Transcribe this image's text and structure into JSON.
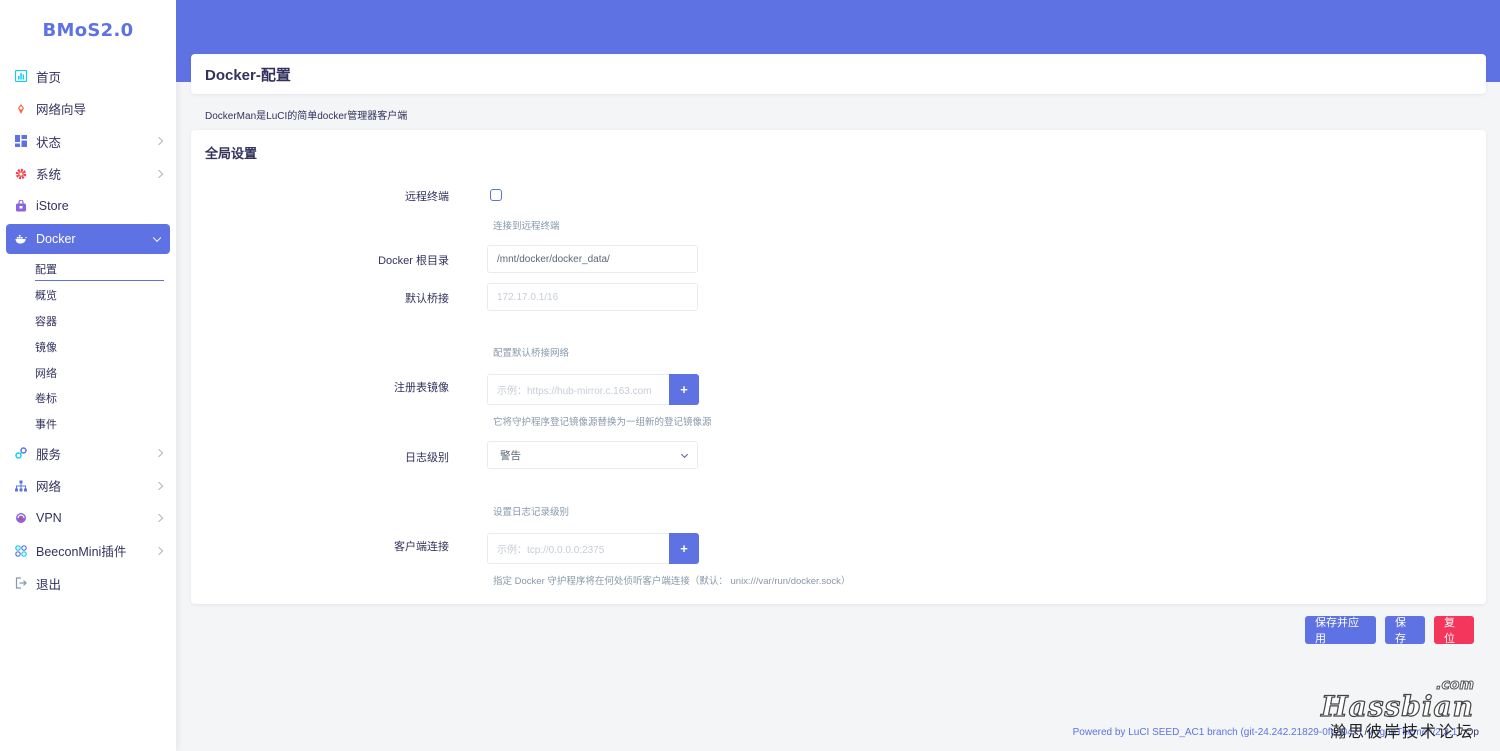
{
  "brand": "BMoS2.0",
  "sidebar": {
    "items": [
      {
        "label": "首页",
        "icon": "dashboard-icon"
      },
      {
        "label": "网络向导",
        "icon": "wizard-icon"
      },
      {
        "label": "状态",
        "icon": "grid-icon"
      },
      {
        "label": "系统",
        "icon": "gear-icon"
      },
      {
        "label": "iStore",
        "icon": "store-icon"
      },
      {
        "label": "Docker",
        "icon": "docker-icon"
      },
      {
        "label": "服务",
        "icon": "services-icon"
      },
      {
        "label": "网络",
        "icon": "network-icon"
      },
      {
        "label": "VPN",
        "icon": "vpn-icon"
      },
      {
        "label": "BeeconMini插件",
        "icon": "plugin-icon"
      },
      {
        "label": "退出",
        "icon": "logout-icon"
      }
    ],
    "docker_sub": [
      "配置",
      "概览",
      "容器",
      "镜像",
      "网络",
      "卷标",
      "事件"
    ]
  },
  "page": {
    "title": "Docker-配置",
    "description": "DockerMan是LuCI的简单docker管理器客户端"
  },
  "section": {
    "title": "全局设置",
    "remote_terminal": {
      "label": "远程终端",
      "help": "连接到远程终端",
      "checked": false
    },
    "docker_root": {
      "label": "Docker 根目录",
      "value": "/mnt/docker/docker_data/"
    },
    "default_bridge": {
      "label": "默认桥接",
      "placeholder": "172.17.0.1/16",
      "help": "配置默认桥接网络"
    },
    "registry_mirror": {
      "label": "注册表镜像",
      "placeholder": "示例：https://hub-mirror.c.163.com",
      "add": "+",
      "help": "它将守护程序登记镜像源替换为一组新的登记镜像源"
    },
    "log_level": {
      "label": "日志级别",
      "value": "警告",
      "help": "设置日志记录级别"
    },
    "client_conn": {
      "label": "客户端连接",
      "placeholder": "示例：tcp://0.0.0.0:2375",
      "add": "+",
      "help": "指定 Docker 守护程序将在何处侦听客户端连接（默认： unix:///var/run/docker.sock）"
    }
  },
  "actions": {
    "save_apply": "保存并应用",
    "save": "保存",
    "reset": "复位"
  },
  "footer": {
    "powered": "Powered by LuCI SEED_AC1 branch (git-24.242.21829-0fea047)",
    "sep": " / ",
    "theme": "ArgonTheme v2.3.1",
    "rest": " / Op"
  },
  "watermark": {
    "com": ".com",
    "main": "Hassbian",
    "sub": "瀚思彼岸技术论坛"
  },
  "colors": {
    "accent": "#5e72e4",
    "danger": "#f5365c"
  }
}
